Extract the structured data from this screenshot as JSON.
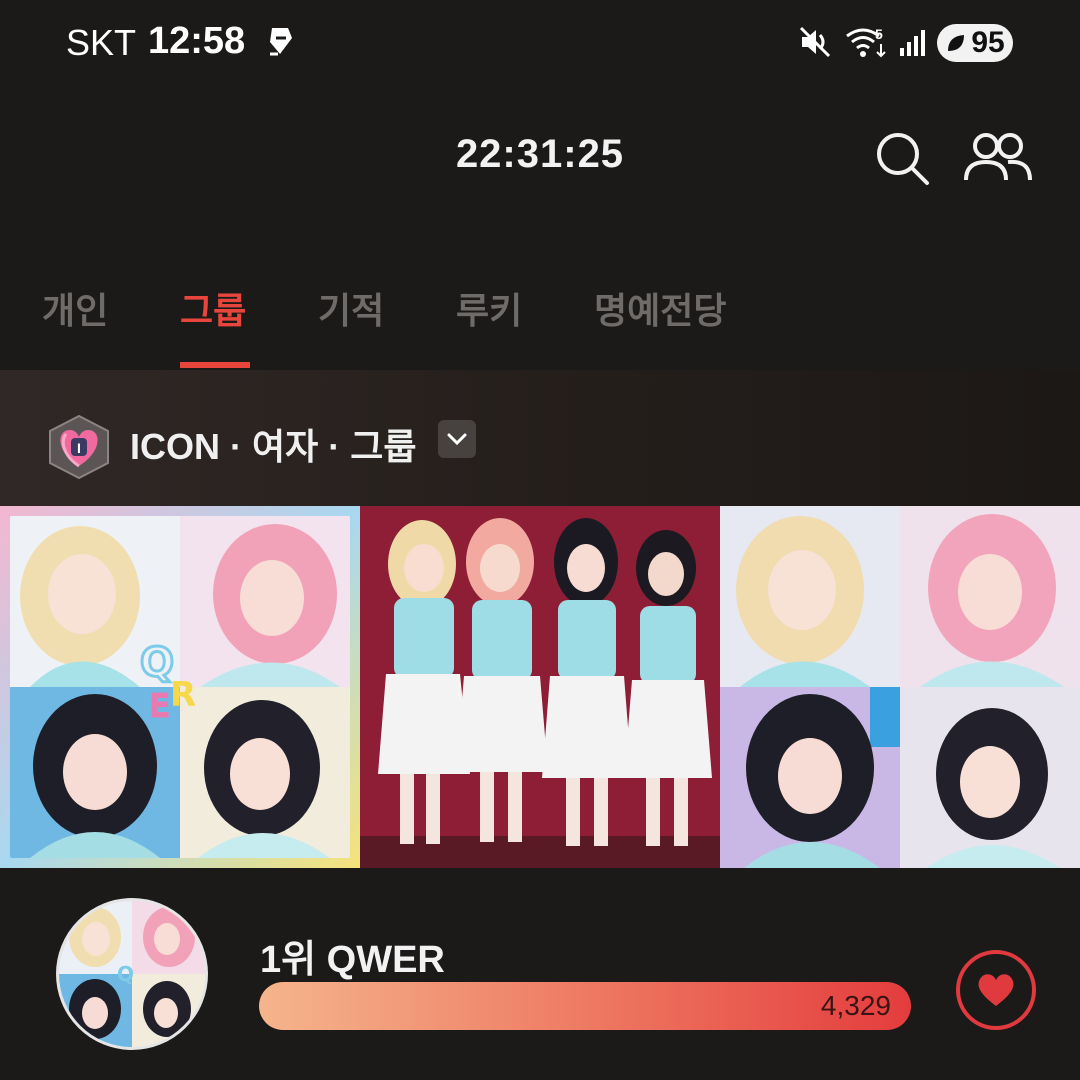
{
  "status_bar": {
    "carrier": "SKT",
    "time": "12:58",
    "battery": "95",
    "wifi_badge": "5"
  },
  "header": {
    "time": "22:31:25",
    "icons": [
      "search-icon",
      "people-icon"
    ]
  },
  "tabs": [
    {
      "label": "개인",
      "active": false
    },
    {
      "label": "그룹",
      "active": true
    },
    {
      "label": "기적",
      "active": false
    },
    {
      "label": "루키",
      "active": false
    },
    {
      "label": "명예전당",
      "active": false
    }
  ],
  "category": {
    "badge_letter": "I",
    "title": "ICON · 여자 · 그룹"
  },
  "ranking": {
    "label": "1위 QWER",
    "votes": "4,329"
  },
  "colors": {
    "accent": "#e8453c",
    "background": "#1c1a19",
    "inactive_tab": "#6f6b69"
  }
}
